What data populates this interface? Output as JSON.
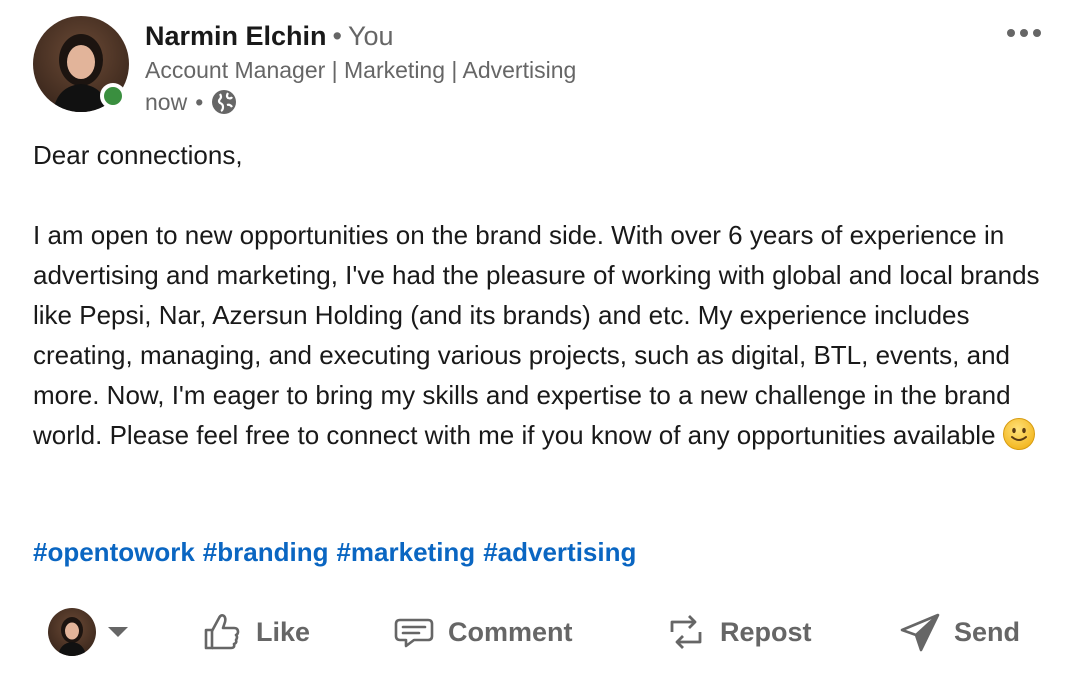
{
  "post": {
    "author": {
      "name": "Narmin Elchin",
      "separator": "•",
      "relation": "You",
      "headline": "Account Manager | Marketing | Advertising",
      "timestamp": "now",
      "meta_separator": "•",
      "visibility_icon": "globe-icon",
      "online_status_color": "#3a8f3f"
    },
    "more_icon": "ellipsis-icon",
    "body": {
      "greeting": "Dear connections,",
      "paragraph": "I am open to new opportunities on the brand side. With over 6 years of experience in advertising and marketing, I've had the pleasure of working with global and local brands like Pepsi, Nar, Azersun Holding (and its brands) and etc. My experience includes creating, managing, and executing various projects, such as digital, BTL, events, and more. Now, I'm eager to bring my skills and expertise to a new challenge in the brand world. Please feel free to connect with me if you know of any opportunities available",
      "emoji": "slightly-smiling-face"
    },
    "hashtags": [
      "#opentowork",
      "#branding",
      "#marketing",
      "#advertising"
    ],
    "hashtag_color": "#0a66c2"
  },
  "actions": {
    "like": "Like",
    "comment": "Comment",
    "repost": "Repost",
    "send": "Send",
    "icon_color": "#666666"
  }
}
